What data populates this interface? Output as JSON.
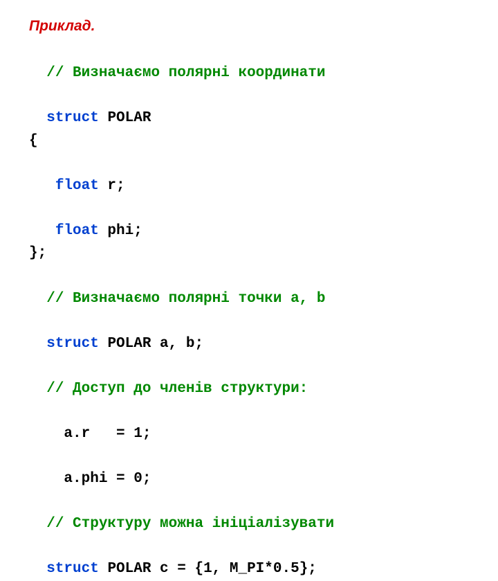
{
  "heading": "Приклад.",
  "code": {
    "c1": "// Визначаємо полярні координати",
    "struct_kw": "struct",
    "polar_name": " POLAR",
    "brace_open": "{",
    "float_kw": "float",
    "field_r": " r;",
    "field_phi": " phi;",
    "brace_close": "};",
    "c2": "// Визначаємо полярні точки a, b",
    "decl_ab": " POLAR a, b;",
    "c3": "// Доступ до членів структури:",
    "assign_r": "a.r   = 1;",
    "assign_phi": "a.phi = 0;",
    "c4": "// Структуру можна ініціалізувати",
    "decl_c": " POLAR c = {1, M_PI*0.5};"
  }
}
